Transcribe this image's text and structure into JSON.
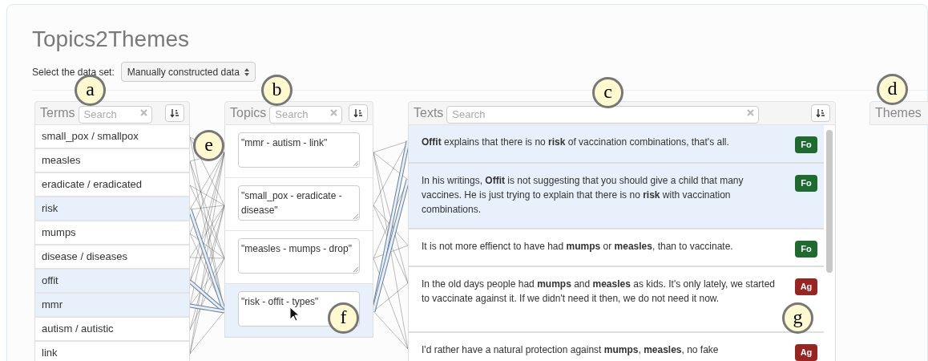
{
  "title": "Topics2Themes",
  "dataset_select": {
    "label": "Select the data set:",
    "value": "Manually constructed data"
  },
  "terms": {
    "heading": "Terms",
    "search_placeholder": "Search",
    "items": [
      {
        "label": "small_pox / smallpox",
        "selected": false
      },
      {
        "label": "measles",
        "selected": false
      },
      {
        "label": "eradicate / eradicated",
        "selected": false
      },
      {
        "label": "risk",
        "selected": true
      },
      {
        "label": "mumps",
        "selected": false
      },
      {
        "label": "disease / diseases",
        "selected": false
      },
      {
        "label": "offit",
        "selected": true
      },
      {
        "label": "mmr",
        "selected": true
      },
      {
        "label": "autism / autistic",
        "selected": false
      },
      {
        "label": "link",
        "selected": false
      }
    ]
  },
  "topics": {
    "heading": "Topics",
    "search_placeholder": "Search",
    "items": [
      {
        "label": "\"mmr - autism - link\"",
        "selected": false
      },
      {
        "label": "\"small_pox - eradicate - disease\"",
        "selected": false
      },
      {
        "label": "\"measles - mumps - drop\"",
        "selected": false
      },
      {
        "label": "\"risk - offit - types\"",
        "selected": true
      }
    ]
  },
  "texts": {
    "heading": "Texts",
    "search_placeholder": "Search",
    "items": [
      {
        "text": "**Offit** explains that there is no **risk** of vaccination combinations, that's all.",
        "selected": true,
        "tag": {
          "label": "Fo",
          "color": "#1e6b30"
        }
      },
      {
        "text": "In his writings, **Offit** is not suggesting that you should give a child that many vaccines. He is just trying to explain that there is no **risk** with vaccination combinations.",
        "selected": true,
        "tag": {
          "label": "Fo",
          "color": "#1e6b30"
        }
      },
      {
        "text": "It is not more effienct to have had **mumps** or **measles**, than to vaccinate.",
        "selected": false,
        "tag": {
          "label": "Fo",
          "color": "#1e6b30"
        }
      },
      {
        "text": "In the old days people had **mumps** and **measles** as kids. It's only lately, we started to vaccinate against it. If we didn't need it then, we do not need it now.",
        "selected": false,
        "tag": {
          "label": "Ag",
          "color": "#9a2420"
        }
      },
      {
        "text": "I'd rather have a natural protection against **mumps**, **measles**, no fake",
        "selected": false,
        "tag": {
          "label": "Ag",
          "color": "#9a2420"
        }
      }
    ]
  },
  "themes": {
    "heading": "Themes"
  },
  "annotations": [
    {
      "label": "a"
    },
    {
      "label": "b"
    },
    {
      "label": "c"
    },
    {
      "label": "d"
    },
    {
      "label": "e"
    },
    {
      "label": "f"
    },
    {
      "label": "g"
    }
  ]
}
